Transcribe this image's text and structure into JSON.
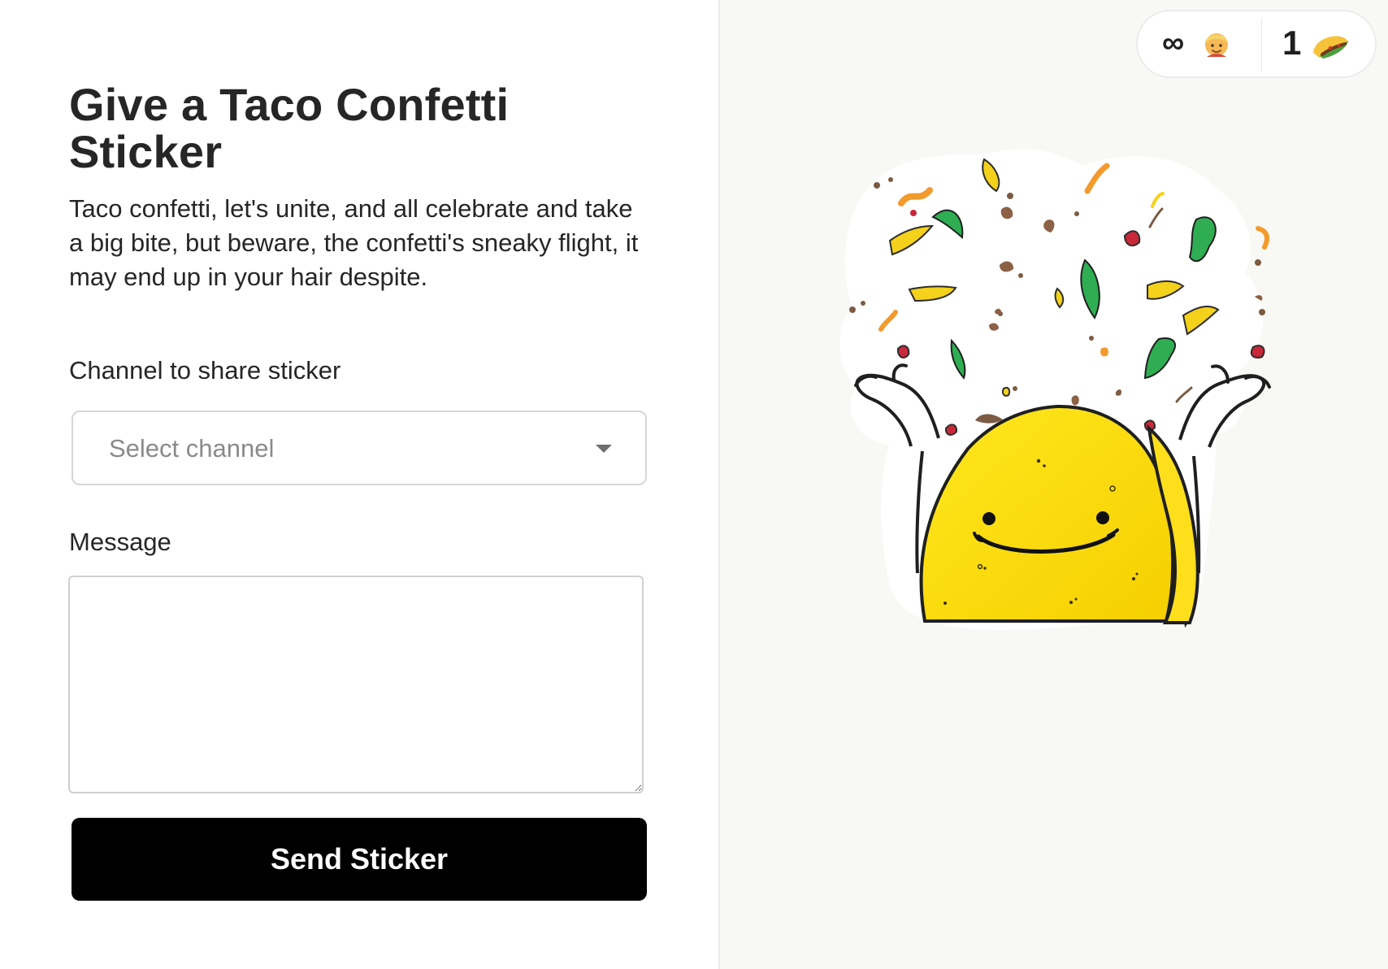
{
  "form": {
    "title": "Give a Taco Confetti Sticker",
    "description": "Taco confetti, let's unite, and all celebrate and take a big bite, but beware, the confetti's sneaky flight, it may end up in your hair despite.",
    "channel_label": "Channel to share sticker",
    "channel_placeholder": "Select channel",
    "message_label": "Message",
    "message_value": "",
    "send_label": "Send Sticker"
  },
  "stats": {
    "infinity": "∞",
    "person_icon": "person-icon",
    "taco_count": "1",
    "taco_icon": "taco-icon"
  },
  "colors": {
    "accent": "#000000",
    "panel_background": "#f8f8f5",
    "taco_yellow": "#ffdf1c"
  },
  "sticker": {
    "name": "taco-confetti-sticker"
  }
}
